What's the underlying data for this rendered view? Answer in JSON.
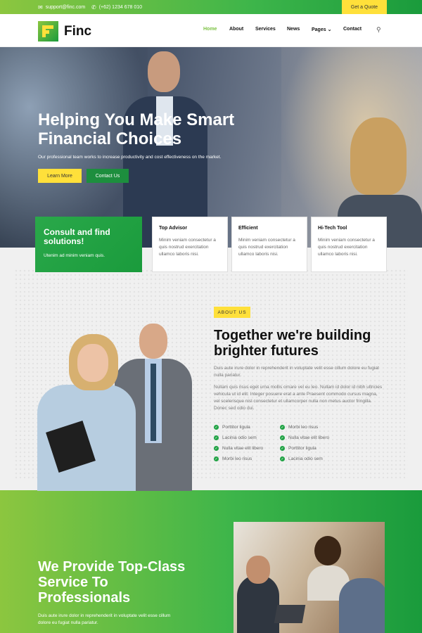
{
  "topbar": {
    "email": "support@finc.com",
    "phone": "(+62) 1234 678 010",
    "quote_button": "Get a Quote",
    "email_icon": "envelope-icon",
    "phone_icon": "phone-icon"
  },
  "brand": {
    "name": "Finc",
    "colors": {
      "green": "#21a345",
      "light_green": "#8cc63f",
      "yellow": "#ffe03a"
    }
  },
  "nav": {
    "items": [
      "Home",
      "About",
      "Services",
      "News",
      "Pages",
      "Contact"
    ],
    "active": "Home",
    "search_icon": "search-icon"
  },
  "hero": {
    "title": "Helping You Make Smart Financial Choices",
    "subtitle": "Our professional team works to increase productivity and cost effectiveness on the market.",
    "btn_primary": "Learn More",
    "btn_secondary": "Contact Us"
  },
  "consult": {
    "title": "Consult and find solutions!",
    "text": "Utenim ad minim veniam quis."
  },
  "features": [
    {
      "title": "Top Advisor",
      "text": "Minim veniam consectetur a quis nostrud exercitation ullamco laboris nisi."
    },
    {
      "title": "Efficient",
      "text": "Minim veniam consectetur a quis nostrud exercitation ullamco laboris nisi."
    },
    {
      "title": "Hi-Tech Tool",
      "text": "Minim veniam consectetur a quis nostrud exercitation ullamco laboris nisi."
    }
  ],
  "about": {
    "tag": "ABOUT US",
    "title": "Together we're building brighter futures",
    "para1": "Duis aute irure dolor in reprehenderit in voluptate velit esse cillum dolore eu fugiat nulla pariatur.",
    "para2": "Nullam quis risus eget urna mollis ornare vel eu leo. Nullam id dolor id nibh ultricies vehicula ut id elit. Integer posuere erat a ante Praesent commodo cursus magna, vel scelerisque nisl consectetur et ullamcorper nulla non metus auctor fringilla. Donec sed odio dui.",
    "list_left": [
      "Porttitor ligula",
      "Lacinia odio sem",
      "Nulla vitae elit libero",
      "Morbi leo risus"
    ],
    "list_right": [
      "Morbi leo risus",
      "Nulla vitae elit libero",
      "Porttitor ligula",
      "Lacinia odio sem"
    ]
  },
  "services": {
    "title": "We Provide Top-Class Service To Professionals",
    "text": "Duis aute irure dolor in reprehenderit in voluptate velit esse cillum dolore eu fugiat nulla pariatur."
  }
}
